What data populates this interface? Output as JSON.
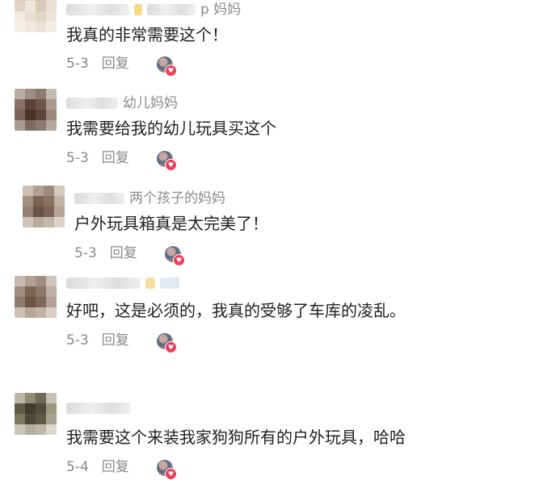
{
  "comments": [
    {
      "name_suffix": "p 妈妈",
      "text": "我真的非常需要这个！",
      "date": "5-3",
      "reply": "回复"
    },
    {
      "name_suffix": "幼儿妈妈",
      "text": "我需要给我的幼儿玩具买这个",
      "date": "5-3",
      "reply": "回复"
    },
    {
      "name_suffix": "两个孩子的妈妈",
      "text": "户外玩具箱真是太完美了！",
      "date": "5-3",
      "reply": "回复"
    },
    {
      "name_suffix": "",
      "text": "好吧，这是必须的，我真的受够了车库的凌乱。",
      "date": "5-3",
      "reply": "回复"
    },
    {
      "name_suffix": "",
      "text": "我需要这个来装我家狗狗所有的户外玩具，哈哈",
      "date": "5-4",
      "reply": "回复"
    }
  ],
  "icons": {
    "liked_badge": "heart-icon",
    "avatar": "blurred-avatar"
  },
  "colors": {
    "heart": "#ef3e5b",
    "meta_text": "#8a8a8a",
    "body_text": "#1f1f1f"
  }
}
